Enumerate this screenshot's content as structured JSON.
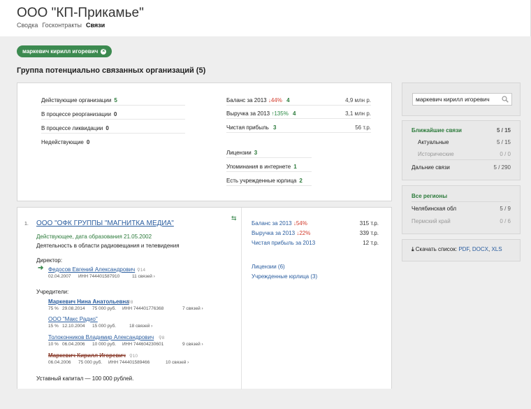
{
  "header": {
    "title": "ООО \"КП-Прикамье\"",
    "tabs": [
      {
        "label": "Сводка",
        "active": false
      },
      {
        "label": "Госконтракты",
        "active": false
      },
      {
        "label": "Связи",
        "active": true
      }
    ]
  },
  "filter_chip": {
    "label": "маркевич кирилл игоревич"
  },
  "group_heading": "Группа потенциально связанных организаций (5)",
  "summary": {
    "left": [
      {
        "label": "Действующие организации",
        "value": "5"
      },
      {
        "label": "В процессе реорганизации",
        "value": "0"
      },
      {
        "label": "В процессе ликвидации",
        "value": "0"
      },
      {
        "label": "Недействующие",
        "value": "0"
      }
    ],
    "balance": {
      "label": "Баланс за 2013",
      "change": "44%",
      "value": "4",
      "amount": "4,9 млн р."
    },
    "revenue": {
      "label": "Выручка за 2013",
      "change": "135%",
      "value": "4",
      "amount": "3,1 млн р."
    },
    "profit": {
      "label": "Чистая прибыль",
      "value": "3",
      "amount": "56 т.р."
    },
    "licenses": {
      "label": "Лицензии",
      "value": "3"
    },
    "mentions": {
      "label": "Упоминания в интернете",
      "value": "1"
    },
    "founded": {
      "label": "Есть учрежденные юрлица",
      "value": "2"
    }
  },
  "org": {
    "index": "1.",
    "name": "ООО \"ОФК ГРУППЫ \"МАГНИТКА МЕДИА\"",
    "status": "Действующее, дата образования 21.05.2002",
    "activity": "Деятельность в области радиовещания и телевидения",
    "director_label": "Директор:",
    "director": {
      "name": "Федосов Евгений Александрович",
      "count": "14",
      "date": "02.04.2007",
      "inn": "ИНН 744401587910",
      "links": "11 связей"
    },
    "founders_label": "Учредители:",
    "founders": [
      {
        "name": "Маркевич Нина Анатольевна",
        "count": "8",
        "share": "75 %",
        "date": "29.08.2014",
        "amount": "75 000 руб.",
        "inn": "ИНН 744401776368",
        "links": "7 связей",
        "struck": false
      },
      {
        "name": "ООО \"Макс Радио\"",
        "count": "",
        "share": "15 %",
        "date": "12.10.2004",
        "amount": "15 000 руб.",
        "inn": "",
        "links": "18 связей",
        "struck": false
      },
      {
        "name": "Толоконников Владимир Александрович",
        "count": "8",
        "share": "10 %",
        "date": "06.04.2006",
        "amount": "10 000 руб.",
        "inn": "ИНН 744604230601",
        "links": "9 связей",
        "struck": false
      },
      {
        "name": "Маркевич Кирилл Игоревич",
        "count": "10",
        "share": "",
        "date": "06.04.2006",
        "amount": "75 000 руб.",
        "inn": "ИНН 744401589466",
        "links": "10 связей",
        "struck": true
      }
    ],
    "capital": "Уставный капитал — 100 000 рублей.",
    "fin": [
      {
        "label": "Баланс за 2013",
        "change": "54%",
        "amount": "315 т.р."
      },
      {
        "label": "Выручка за 2013",
        "change": "22%",
        "amount": "339 т.р."
      },
      {
        "label": "Чистая прибыль за 2013",
        "change": "",
        "amount": "12 т.р."
      }
    ],
    "licenses": "Лицензии (6)",
    "founded": "Учрежденные юрлица (3)"
  },
  "sidebar": {
    "search_value": "маркевич кирилл игоревич",
    "links": {
      "closest_label": "Ближайшие связи",
      "closest_value": "5 / 15",
      "actual_label": "Актуальные",
      "actual_value": "5 / 15",
      "historic_label": "Исторические",
      "historic_value": "0 / 0",
      "distant_label": "Дальние связи",
      "distant_value": "5 / 290"
    },
    "regions": {
      "all_label": "Все регионы",
      "items": [
        {
          "label": "Челябинская обл",
          "value": "5 / 9"
        },
        {
          "label": "Пермский край",
          "value": "0 / 6"
        }
      ]
    },
    "download": {
      "label": "Скачать список:",
      "pdf": "PDF",
      "docx": "DOCX",
      "xls": "XLS"
    }
  },
  "colors": {
    "accent_green": "#3c8a50",
    "link_blue": "#2a5d9f",
    "down_red": "#d23b2b"
  }
}
